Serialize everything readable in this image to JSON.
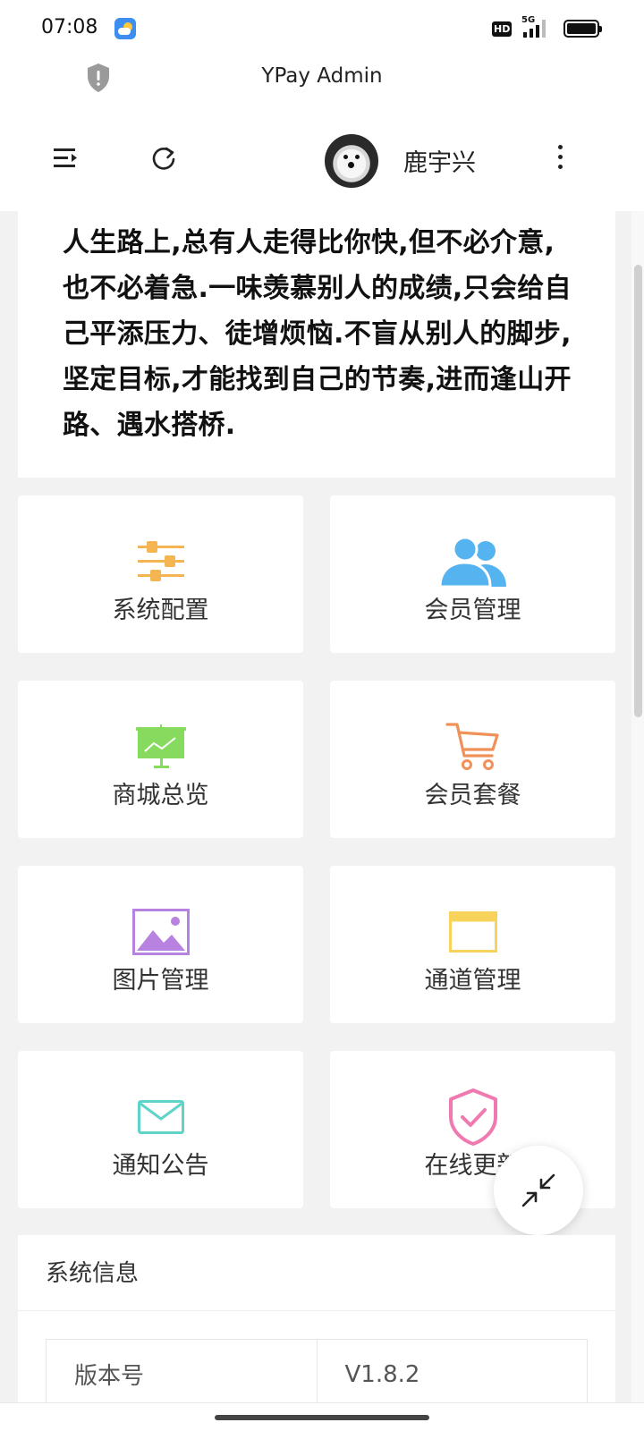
{
  "status_bar": {
    "time": "07:08",
    "hd": "HD",
    "network": "5G"
  },
  "app": {
    "title": "YPay Admin"
  },
  "toolbar": {
    "user_name": "鹿宇兴"
  },
  "quote": {
    "text": "人生路上,总有人走得比你快,但不必介意,也不必着急.一味羡慕别人的成绩,只会给自己平添压力、徒增烦恼.不盲从别人的脚步,坚定目标,才能找到自己的节奏,进而逢山开路、遇水搭桥."
  },
  "tiles": [
    {
      "label": "系统配置",
      "icon": "sliders-icon",
      "color": "#f5b553"
    },
    {
      "label": "会员管理",
      "icon": "users-icon",
      "color": "#55b3f0"
    },
    {
      "label": "商城总览",
      "icon": "presentation-board-icon",
      "color": "#86db5e"
    },
    {
      "label": "会员套餐",
      "icon": "shopping-cart-icon",
      "color": "#f0915a"
    },
    {
      "label": "图片管理",
      "icon": "image-icon",
      "color": "#b882e0"
    },
    {
      "label": "通道管理",
      "icon": "window-icon",
      "color": "#f8d35c"
    },
    {
      "label": "通知公告",
      "icon": "envelope-icon",
      "color": "#5fd3c8"
    },
    {
      "label": "在线更新",
      "icon": "shield-check-icon",
      "color": "#f07ab0"
    }
  ],
  "system_info": {
    "title": "系统信息",
    "rows": [
      {
        "key": "版本号",
        "value": "V1.8.2"
      }
    ]
  }
}
